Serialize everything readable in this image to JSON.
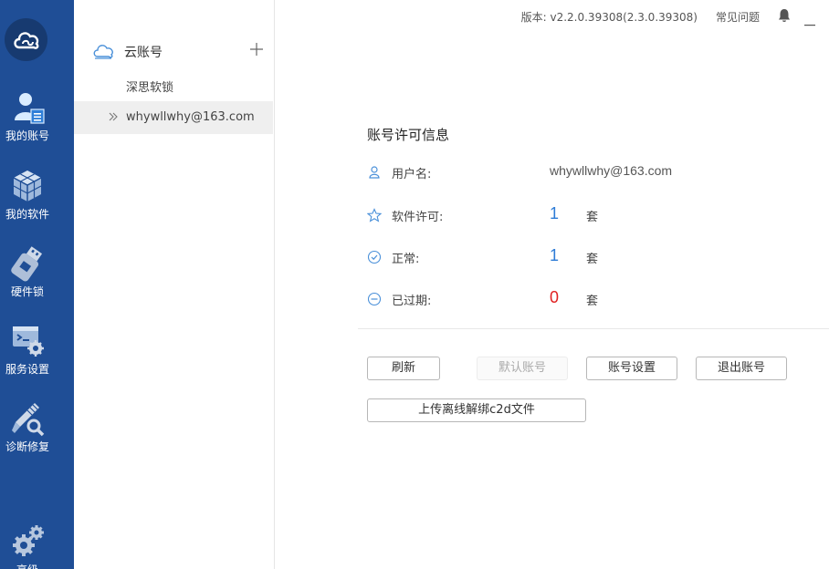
{
  "nav": {
    "items": [
      {
        "label": "我的账号",
        "icon": "user-account-icon",
        "active": true
      },
      {
        "label": "我的软件",
        "icon": "software-cubes-icon",
        "active": false
      },
      {
        "label": "硬件锁",
        "icon": "usb-dongle-icon",
        "active": false
      },
      {
        "label": "服务设置",
        "icon": "service-settings-icon",
        "active": false
      },
      {
        "label": "诊断修复",
        "icon": "repair-tools-icon",
        "active": false
      },
      {
        "label": "高级",
        "icon": "advanced-gears-icon",
        "active": false
      }
    ]
  },
  "tree": {
    "title": "云账号",
    "children": [
      {
        "label": "深思软锁",
        "selected": false
      },
      {
        "label": "whywllwhy@163.com",
        "selected": true
      }
    ]
  },
  "topbar": {
    "version": "版本: v2.2.0.39308(2.3.0.39308)",
    "faq": "常见问题"
  },
  "account": {
    "title": "账号许可信息",
    "username_label": "用户名:",
    "username": "whywllwhy@163.com",
    "license_label": "软件许可:",
    "license_count": "1",
    "normal_label": "正常:",
    "normal_count": "1",
    "expired_label": "已过期:",
    "expired_count": "0",
    "unit": "套"
  },
  "buttons": {
    "refresh": "刷新",
    "default_account": "默认账号",
    "account_settings": "账号设置",
    "logout": "退出账号",
    "upload": "上传离线解绑c2d文件"
  },
  "colors": {
    "nav_bg": "#1f4e96",
    "accent_blue": "#2d7bd6",
    "expired_red": "#e02020"
  }
}
